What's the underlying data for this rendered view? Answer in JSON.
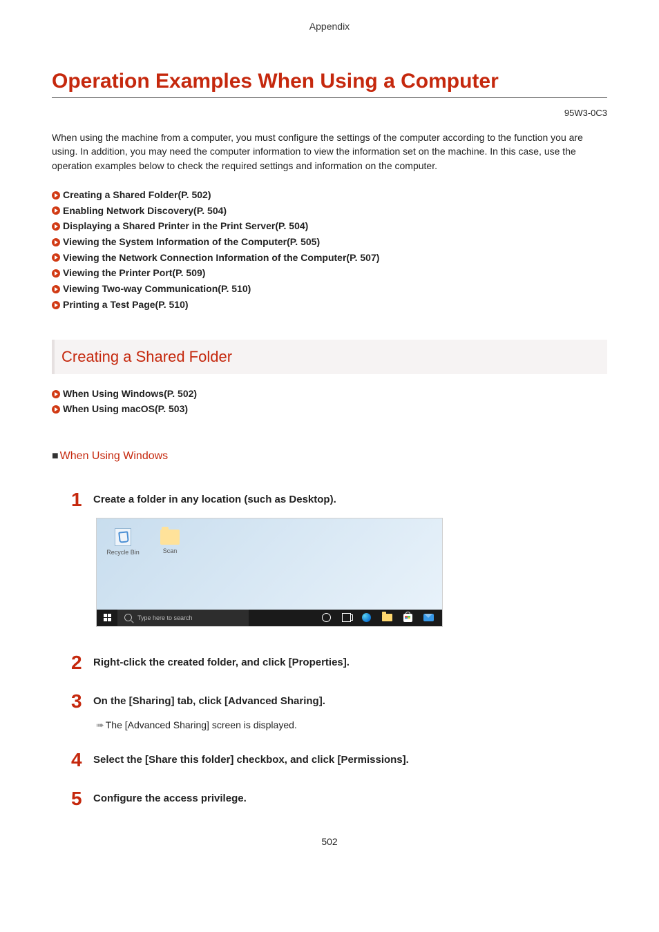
{
  "header": "Appendix",
  "title": "Operation Examples When Using a Computer",
  "doc_code": "95W3-0C3",
  "intro": "When using the machine from a computer, you must configure the settings of the computer according to the function you are using. In addition, you may need the computer information to view the information set on the machine. In this case, use the operation examples below to check the required settings and information on the computer.",
  "links": [
    "Creating a Shared Folder(P. 502)",
    "Enabling Network Discovery(P. 504)",
    "Displaying a Shared Printer in the Print Server(P. 504)",
    "Viewing the System Information of the Computer(P. 505)",
    "Viewing the Network Connection Information of the Computer(P. 507)",
    "Viewing the Printer Port(P. 509)",
    "Viewing Two-way Communication(P. 510)",
    "Printing a Test Page(P. 510)"
  ],
  "section1_title": "Creating a Shared Folder",
  "sub_links": [
    "When Using Windows(P. 502)",
    "When Using macOS(P. 503)"
  ],
  "subhead": "When Using Windows",
  "steps": {
    "s1": "Create a folder in any location (such as Desktop).",
    "s2": "Right-click the created folder, and click [Properties].",
    "s3": "On the [Sharing] tab, click [Advanced Sharing].",
    "s3_note": "The [Advanced Sharing] screen is displayed.",
    "s4": "Select the [Share this folder] checkbox, and click [Permissions].",
    "s5": "Configure the access privilege."
  },
  "desktop": {
    "recycle_label": "Recycle Bin",
    "scan_label": "Scan",
    "search_placeholder": "Type here to search"
  },
  "page_number": "502"
}
